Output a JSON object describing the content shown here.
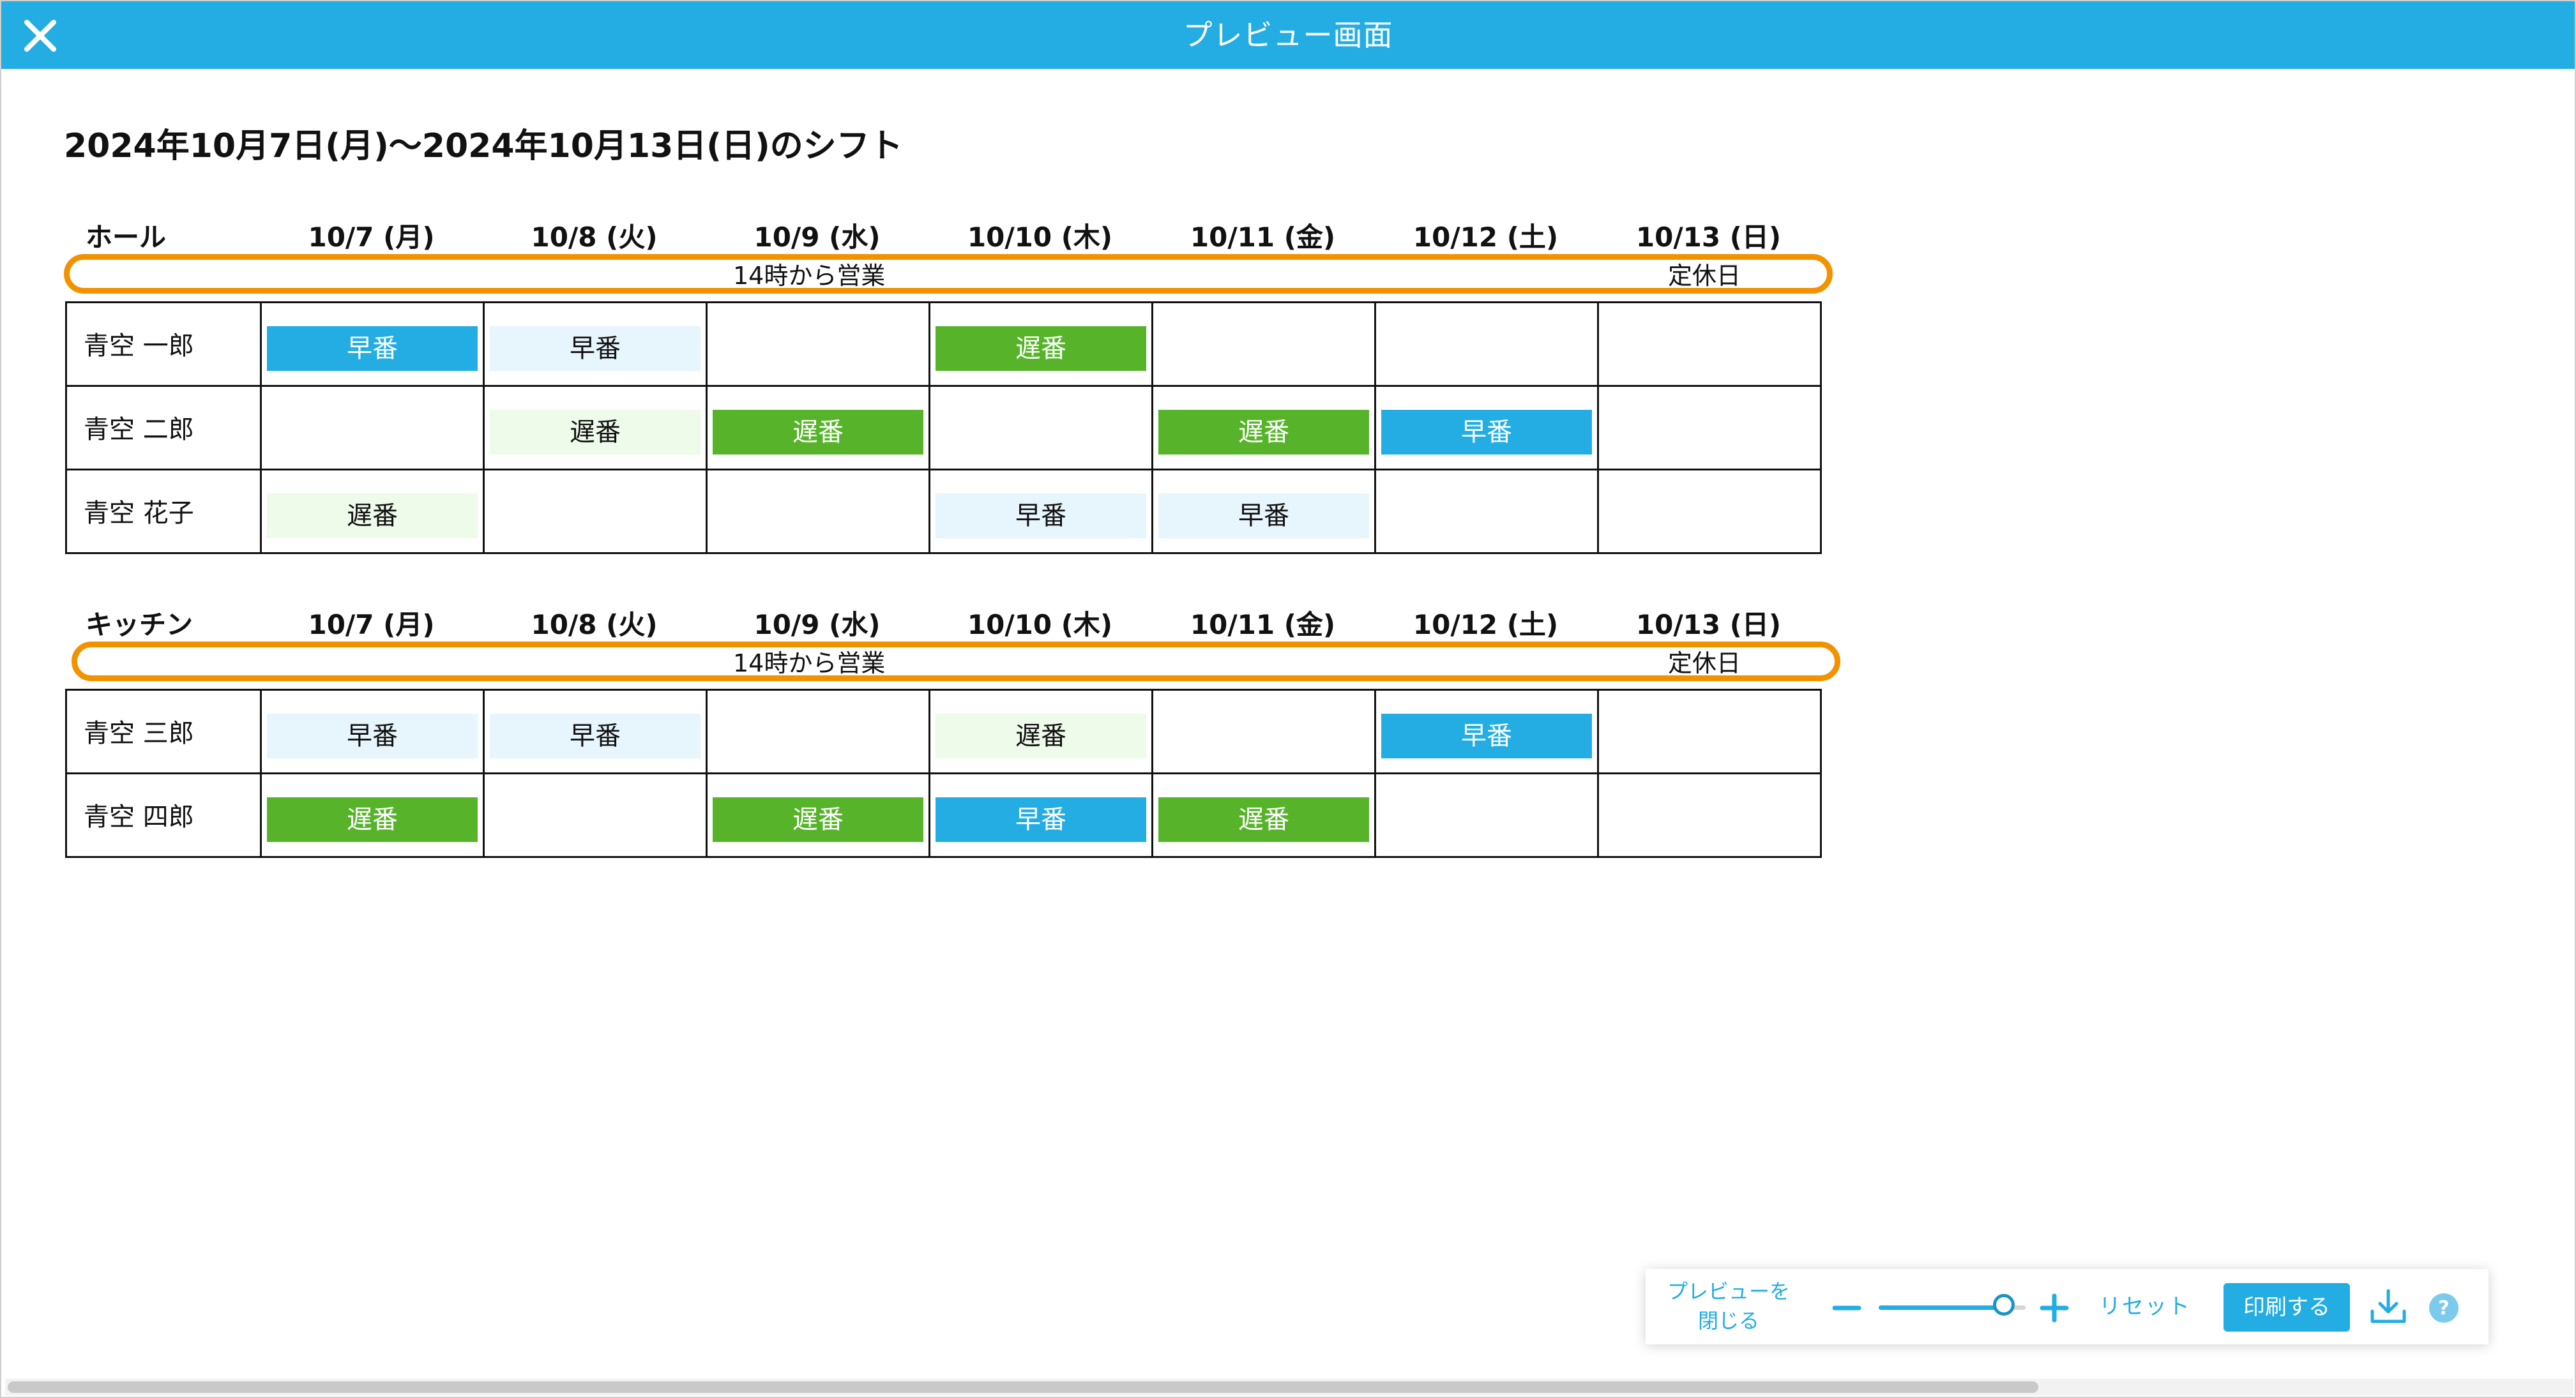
{
  "window": {
    "title": "プレビュー画面"
  },
  "page": {
    "heading": "2024年10月7日(月)〜2024年10月13日(日)のシフト"
  },
  "days": [
    "10/7 (月)",
    "10/8 (火)",
    "10/9 (水)",
    "10/10 (木)",
    "10/11 (金)",
    "10/12 (土)",
    "10/13 (日)"
  ],
  "sections": [
    {
      "name": "ホール",
      "notes": [
        "14時から営業",
        "定休日"
      ],
      "staff": [
        {
          "name": "青空 一郎",
          "shifts": [
            "早番",
            "早番",
            "",
            "遅番",
            "",
            "",
            ""
          ],
          "styles": [
            "early-solid",
            "early-light",
            "",
            "late-solid",
            "",
            "",
            ""
          ]
        },
        {
          "name": "青空 二郎",
          "shifts": [
            "",
            "遅番",
            "遅番",
            "",
            "遅番",
            "早番",
            ""
          ],
          "styles": [
            "",
            "late-light",
            "late-solid",
            "",
            "late-solid",
            "early-solid",
            ""
          ]
        },
        {
          "name": "青空 花子",
          "shifts": [
            "遅番",
            "",
            "",
            "早番",
            "早番",
            "",
            ""
          ],
          "styles": [
            "late-light",
            "",
            "",
            "early-light",
            "early-light",
            "",
            ""
          ]
        }
      ]
    },
    {
      "name": "キッチン",
      "notes": [
        "14時から営業",
        "定休日"
      ],
      "staff": [
        {
          "name": "青空 三郎",
          "shifts": [
            "早番",
            "早番",
            "",
            "遅番",
            "",
            "早番",
            ""
          ],
          "styles": [
            "early-light",
            "early-light",
            "",
            "late-light",
            "",
            "early-solid",
            ""
          ]
        },
        {
          "name": "青空 四郎",
          "shifts": [
            "遅番",
            "",
            "遅番",
            "早番",
            "遅番",
            "",
            ""
          ],
          "styles": [
            "late-solid",
            "",
            "late-solid",
            "early-solid",
            "late-solid",
            "",
            ""
          ]
        }
      ]
    }
  ],
  "toolbar": {
    "close_preview_label": "プレビューを\n閉じる",
    "reset_label": "リセット",
    "print_label": "印刷する",
    "zoom_level": 0.85
  },
  "colors": {
    "accent": "#23ade3",
    "early_solid": "#23ade3",
    "early_light": "#e7f5fd",
    "late_solid": "#57b42a",
    "late_light": "#eefaea",
    "note_outline": "#f39200"
  },
  "icons": {
    "close": "close-icon",
    "zoom_out": "minus-icon",
    "zoom_in": "plus-icon",
    "download": "download-icon",
    "help": "help-icon"
  }
}
